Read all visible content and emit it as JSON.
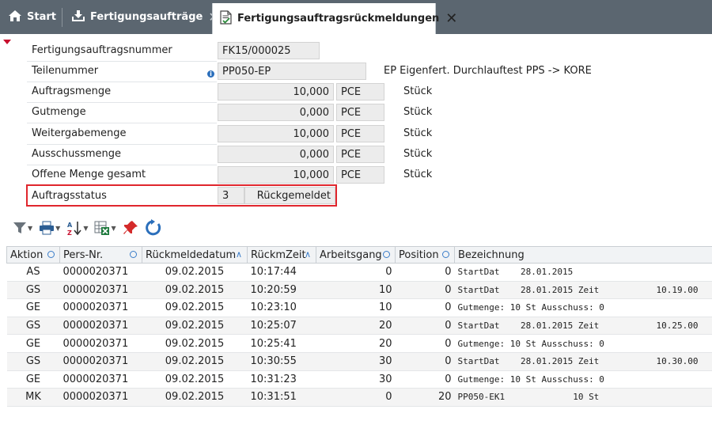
{
  "tabs": {
    "home": "Start",
    "orders": "Fertigungsaufträge",
    "active": "Fertigungsauftragsrückmeldungen"
  },
  "form": {
    "order_no": {
      "label": "Fertigungsauftragsnummer",
      "value": "FK15/000025"
    },
    "part_no": {
      "label": "Teilenummer",
      "value": "PP050-EP",
      "desc": "EP Eigenfert. Durchlauftest PPS -> KORE"
    },
    "order_qty": {
      "label": "Auftragsmenge",
      "value": "10,000",
      "unit": "PCE",
      "unit_text": "Stück"
    },
    "good_qty": {
      "label": "Gutmenge",
      "value": "0,000",
      "unit": "PCE",
      "unit_text": "Stück"
    },
    "pass_qty": {
      "label": "Weitergabemenge",
      "value": "10,000",
      "unit": "PCE",
      "unit_text": "Stück"
    },
    "scrap_qty": {
      "label": "Ausschussmenge",
      "value": "0,000",
      "unit": "PCE",
      "unit_text": "Stück"
    },
    "open_qty": {
      "label": "Offene Menge gesamt",
      "value": "10,000",
      "unit": "PCE",
      "unit_text": "Stück"
    },
    "status": {
      "label": "Auftragsstatus",
      "code": "3",
      "text": "Rückgemeldet"
    }
  },
  "table": {
    "headers": [
      "Aktion",
      "Pers-Nr.",
      "Rückmeldedatum",
      "RückmZeit",
      "Arbeitsgang",
      "Position",
      "Bezeichnung"
    ],
    "rows": [
      {
        "aktion": "AS",
        "pers": "0000020371",
        "datum": "09.02.2015",
        "zeit": "10:17:44",
        "ag": "0",
        "pos": "0",
        "bez": "StartDat    28.01.2015",
        "bez2": ""
      },
      {
        "aktion": "GS",
        "pers": "0000020371",
        "datum": "09.02.2015",
        "zeit": "10:20:59",
        "ag": "10",
        "pos": "0",
        "bez": "StartDat    28.01.2015 Zeit",
        "bez2": "10.19.00"
      },
      {
        "aktion": "GE",
        "pers": "0000020371",
        "datum": "09.02.2015",
        "zeit": "10:23:10",
        "ag": "10",
        "pos": "0",
        "bez": "Gutmenge: 10 St Ausschuss: 0",
        "bez2": ""
      },
      {
        "aktion": "GS",
        "pers": "0000020371",
        "datum": "09.02.2015",
        "zeit": "10:25:07",
        "ag": "20",
        "pos": "0",
        "bez": "StartDat    28.01.2015 Zeit",
        "bez2": "10.25.00"
      },
      {
        "aktion": "GE",
        "pers": "0000020371",
        "datum": "09.02.2015",
        "zeit": "10:25:41",
        "ag": "20",
        "pos": "0",
        "bez": "Gutmenge: 10 St Ausschuss: 0",
        "bez2": ""
      },
      {
        "aktion": "GS",
        "pers": "0000020371",
        "datum": "09.02.2015",
        "zeit": "10:30:55",
        "ag": "30",
        "pos": "0",
        "bez": "StartDat    28.01.2015 Zeit",
        "bez2": "10.30.00"
      },
      {
        "aktion": "GE",
        "pers": "0000020371",
        "datum": "09.02.2015",
        "zeit": "10:31:23",
        "ag": "30",
        "pos": "0",
        "bez": "Gutmenge: 10 St Ausschuss: 0",
        "bez2": ""
      },
      {
        "aktion": "MK",
        "pers": "0000020371",
        "datum": "09.02.2015",
        "zeit": "10:31:51",
        "ag": "0",
        "pos": "20",
        "bez": "PP050-EK1             10 St",
        "bez2": ""
      }
    ]
  },
  "icons": {
    "home": "home-icon",
    "orders": "list-download-icon",
    "active": "document-check-icon",
    "filter": "filter-icon",
    "print": "printer-icon",
    "sort": "sort-az-icon",
    "export": "excel-export-icon",
    "pin": "pin-icon",
    "refresh": "refresh-icon"
  },
  "colors": {
    "tabbar": "#5b6670",
    "highlight": "#e0262d",
    "accent": "#3a7dc9"
  }
}
